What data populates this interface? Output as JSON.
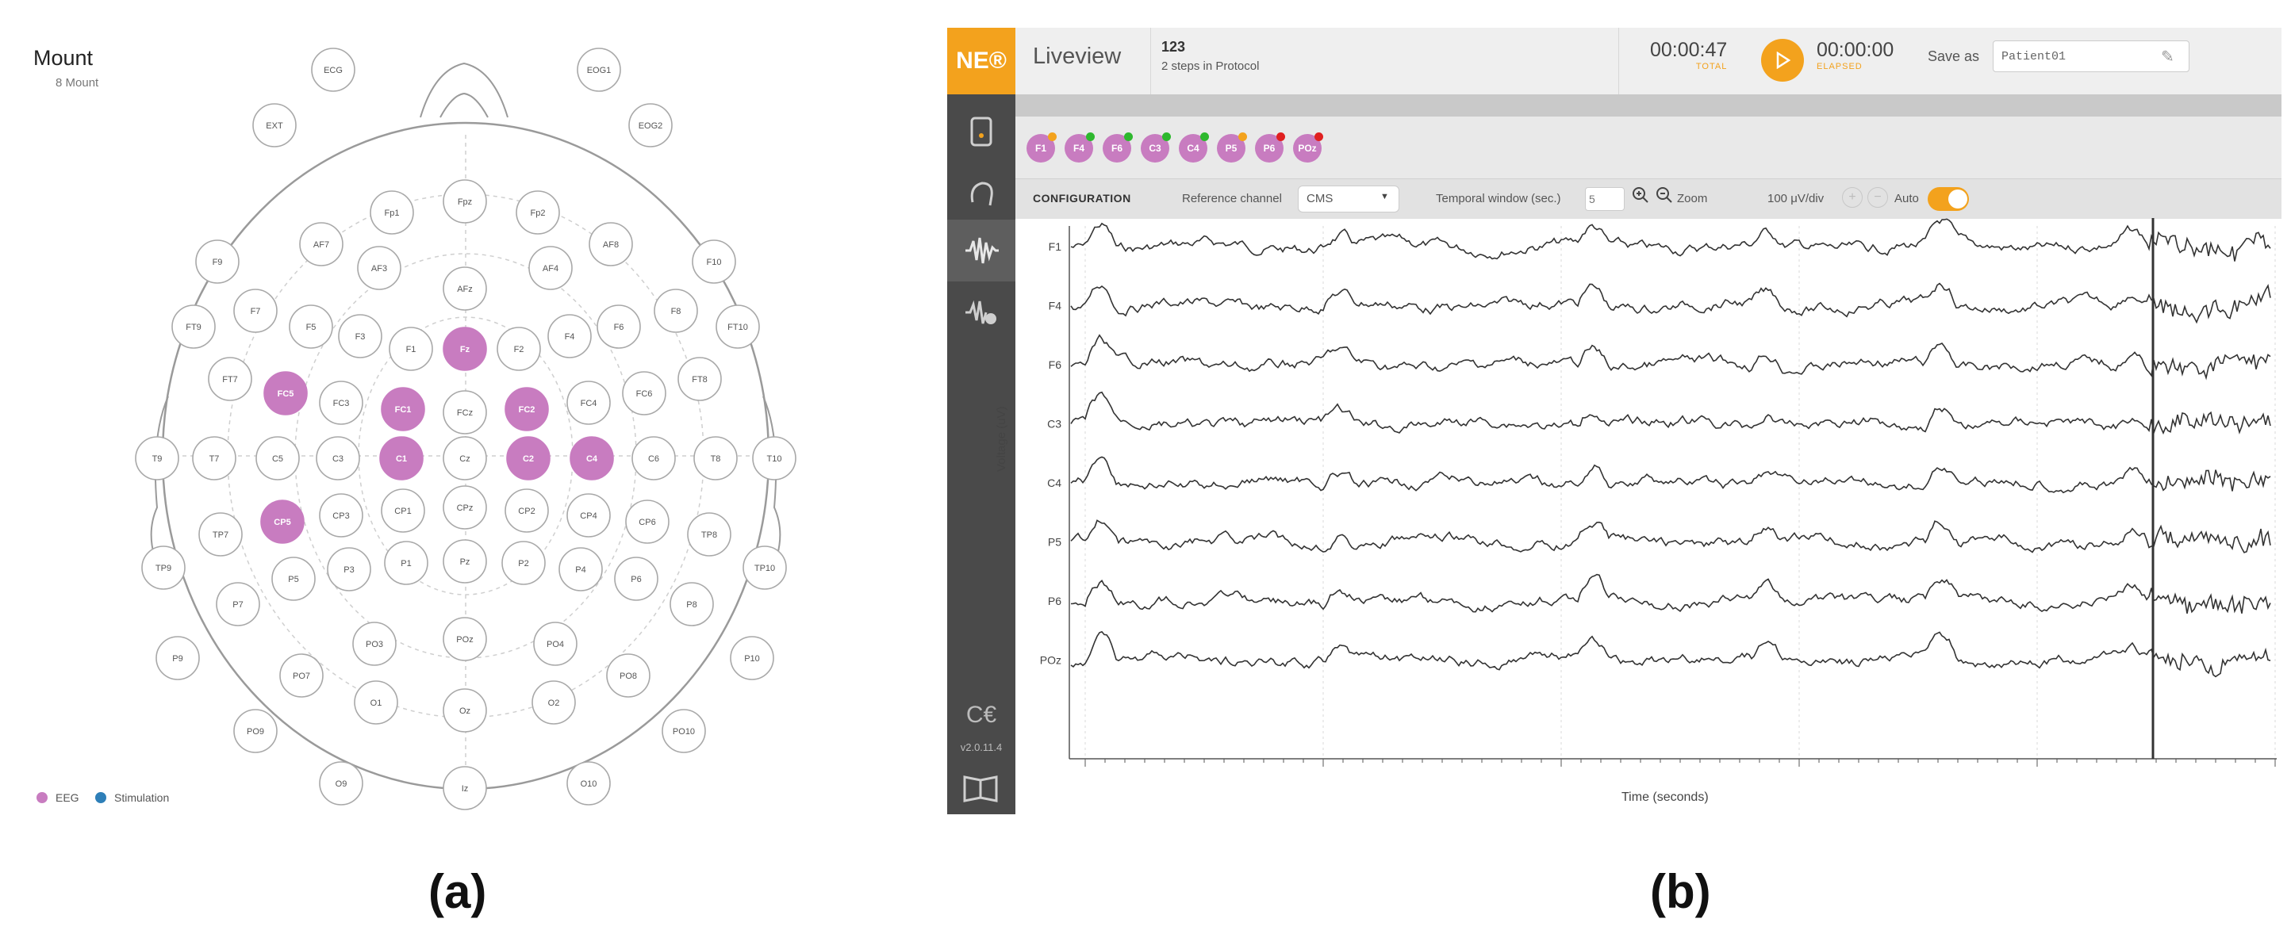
{
  "panel_a": {
    "title": "Mount",
    "subtitle": "8 Mount",
    "legend": [
      {
        "label": "EEG",
        "color": "#c87cc0"
      },
      {
        "label": "Stimulation",
        "color": "#2e7fb8"
      }
    ],
    "active_color": "#c87cc0",
    "electrodes": [
      {
        "label": "ECG",
        "active": false
      },
      {
        "label": "EOG1",
        "active": false
      },
      {
        "label": "EXT",
        "active": false
      },
      {
        "label": "EOG2",
        "active": false
      },
      {
        "label": "Fp1",
        "active": false
      },
      {
        "label": "Fpz",
        "active": false
      },
      {
        "label": "Fp2",
        "active": false
      },
      {
        "label": "F9",
        "active": false
      },
      {
        "label": "AF7",
        "active": false
      },
      {
        "label": "AF8",
        "active": false
      },
      {
        "label": "F10",
        "active": false
      },
      {
        "label": "AF3",
        "active": false
      },
      {
        "label": "AFz",
        "active": false
      },
      {
        "label": "AF4",
        "active": false
      },
      {
        "label": "FT9",
        "active": false
      },
      {
        "label": "F7",
        "active": false
      },
      {
        "label": "F5",
        "active": false
      },
      {
        "label": "F3",
        "active": false
      },
      {
        "label": "F1",
        "active": false
      },
      {
        "label": "Fz",
        "active": true
      },
      {
        "label": "F2",
        "active": false
      },
      {
        "label": "F4",
        "active": false
      },
      {
        "label": "F6",
        "active": false
      },
      {
        "label": "F8",
        "active": false
      },
      {
        "label": "FT10",
        "active": false
      },
      {
        "label": "FT7",
        "active": false
      },
      {
        "label": "FC5",
        "active": true
      },
      {
        "label": "FC3",
        "active": false
      },
      {
        "label": "FC1",
        "active": true
      },
      {
        "label": "FCz",
        "active": false
      },
      {
        "label": "FC2",
        "active": true
      },
      {
        "label": "FC4",
        "active": false
      },
      {
        "label": "FC6",
        "active": false
      },
      {
        "label": "FT8",
        "active": false
      },
      {
        "label": "T9",
        "active": false
      },
      {
        "label": "T7",
        "active": false
      },
      {
        "label": "C5",
        "active": false
      },
      {
        "label": "C3",
        "active": false
      },
      {
        "label": "C1",
        "active": true
      },
      {
        "label": "Cz",
        "active": false
      },
      {
        "label": "C2",
        "active": true
      },
      {
        "label": "C4",
        "active": true
      },
      {
        "label": "C6",
        "active": false
      },
      {
        "label": "T8",
        "active": false
      },
      {
        "label": "T10",
        "active": false
      },
      {
        "label": "TP7",
        "active": false
      },
      {
        "label": "CP5",
        "active": true
      },
      {
        "label": "CP3",
        "active": false
      },
      {
        "label": "CP1",
        "active": false
      },
      {
        "label": "CPz",
        "active": false
      },
      {
        "label": "CP2",
        "active": false
      },
      {
        "label": "CP4",
        "active": false
      },
      {
        "label": "CP6",
        "active": false
      },
      {
        "label": "TP8",
        "active": false
      },
      {
        "label": "TP9",
        "active": false
      },
      {
        "label": "P7",
        "active": false
      },
      {
        "label": "P5",
        "active": false
      },
      {
        "label": "P3",
        "active": false
      },
      {
        "label": "P1",
        "active": false
      },
      {
        "label": "Pz",
        "active": false
      },
      {
        "label": "P2",
        "active": false
      },
      {
        "label": "P4",
        "active": false
      },
      {
        "label": "P6",
        "active": false
      },
      {
        "label": "P8",
        "active": false
      },
      {
        "label": "TP10",
        "active": false
      },
      {
        "label": "P9",
        "active": false
      },
      {
        "label": "PO7",
        "active": false
      },
      {
        "label": "PO3",
        "active": false
      },
      {
        "label": "POz",
        "active": false
      },
      {
        "label": "PO4",
        "active": false
      },
      {
        "label": "PO8",
        "active": false
      },
      {
        "label": "P10",
        "active": false
      },
      {
        "label": "PO9",
        "active": false
      },
      {
        "label": "O1",
        "active": false
      },
      {
        "label": "Oz",
        "active": false
      },
      {
        "label": "O2",
        "active": false
      },
      {
        "label": "PO10",
        "active": false
      },
      {
        "label": "O9",
        "active": false
      },
      {
        "label": "Iz",
        "active": false
      },
      {
        "label": "O10",
        "active": false
      }
    ]
  },
  "panel_b": {
    "logo": "NE®",
    "view_title": "Liveview",
    "protocol_name": "123",
    "protocol_steps": "2 steps in Protocol",
    "total_time": "00:00:47",
    "total_label": "TOTAL",
    "elapsed_time": "00:00:00",
    "elapsed_label": "ELAPSED",
    "save_as_label": "Save as",
    "save_as_value": "Patient01",
    "accent_color": "#f3a21d",
    "version": "v2.0.11.4",
    "channels": [
      {
        "label": "F1",
        "status_color": "#f3a21d"
      },
      {
        "label": "F4",
        "status_color": "#2eb82e"
      },
      {
        "label": "F6",
        "status_color": "#2eb82e"
      },
      {
        "label": "C3",
        "status_color": "#2eb82e"
      },
      {
        "label": "C4",
        "status_color": "#2eb82e"
      },
      {
        "label": "P5",
        "status_color": "#f3a21d"
      },
      {
        "label": "P6",
        "status_color": "#e02020"
      },
      {
        "label": "POz",
        "status_color": "#e02020"
      }
    ],
    "config": {
      "title": "CONFIGURATION",
      "reference_label": "Reference channel",
      "reference_value": "CMS",
      "temporal_label": "Temporal window (sec.)",
      "temporal_value": "5",
      "zoom_label": "Zoom",
      "scale_label": "100 μV/div",
      "auto_label": "Auto",
      "auto_on": true
    },
    "plot": {
      "ylabel": "Voltage (uV)",
      "xlabel": "Time (seconds)",
      "traces": [
        "F1",
        "F4",
        "F6",
        "C3",
        "C4",
        "P5",
        "P6",
        "POz"
      ]
    }
  },
  "panel_labels": [
    "(a)",
    "(b)"
  ]
}
